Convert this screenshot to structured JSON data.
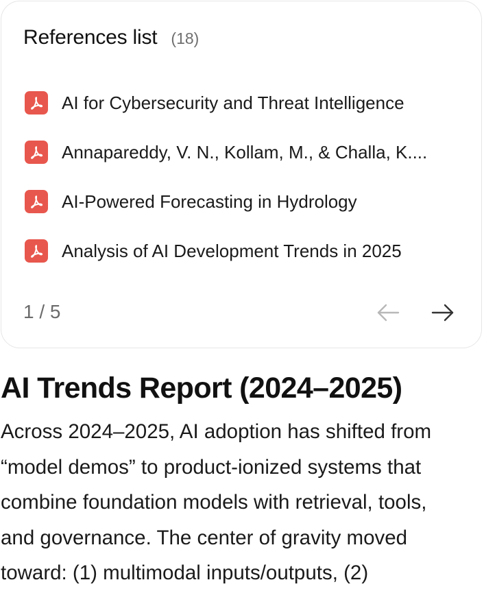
{
  "references": {
    "title": "References list",
    "count": "(18)",
    "items": [
      {
        "label": "AI for Cybersecurity and Threat Intelligence",
        "icon": "pdf-icon"
      },
      {
        "label": "Annapareddy, V. N., Kollam, M., & Challa, K....",
        "icon": "pdf-icon"
      },
      {
        "label": "AI-Powered Forecasting in Hydrology",
        "icon": "pdf-icon"
      },
      {
        "label": "Analysis of AI Development Trends in 2025",
        "icon": "pdf-icon"
      }
    ],
    "pagination": {
      "text": "1 / 5",
      "prev_icon": "arrow-left-icon",
      "next_icon": "arrow-right-icon"
    },
    "colors": {
      "pdf_icon": "#e8574d",
      "prev_arrow": "#b8b8b8",
      "next_arrow": "#333333"
    }
  },
  "report": {
    "title": "AI Trends Report (2024–2025)",
    "lines": [
      "Across 2024–2025, AI adoption has shifted from",
      "“model demos” to product-ionized systems that",
      "combine foundation models with retrieval, tools,",
      "and governance. The center of gravity moved",
      "toward: (1) multimodal inputs/outputs, (2)"
    ]
  }
}
